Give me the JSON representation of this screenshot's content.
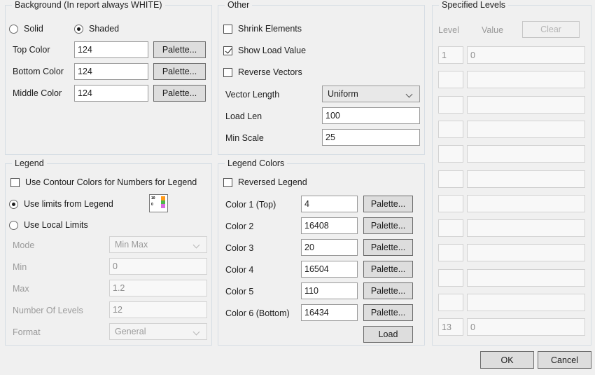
{
  "background_group": {
    "title": "Background (In report always WHITE)",
    "mode_options": [
      {
        "label": "Solid",
        "checked": false
      },
      {
        "label": "Shaded",
        "checked": true
      }
    ],
    "fields": [
      {
        "label": "Top Color",
        "value": "124",
        "button": "Palette..."
      },
      {
        "label": "Bottom Color",
        "value": "124",
        "button": "Palette..."
      },
      {
        "label": "Middle Color",
        "value": "124",
        "button": "Palette..."
      }
    ]
  },
  "legend_group": {
    "title": "Legend",
    "use_contour_colors": {
      "label": "Use Contour Colors for Numbers for Legend",
      "checked": false
    },
    "limits_options": [
      {
        "label": "Use limits from Legend",
        "checked": true
      },
      {
        "label": "Use Local Limits",
        "checked": false
      }
    ],
    "legend_icon": {
      "name": "legend-preview-icon",
      "top_text": "10",
      "bottom_text": "0",
      "colors": [
        "#ff9a18",
        "#4cb84c",
        "#d96ae0"
      ]
    },
    "mode": {
      "label": "Mode",
      "value": "Min Max",
      "disabled": true
    },
    "min": {
      "label": "Min",
      "value": "0",
      "disabled": true
    },
    "max": {
      "label": "Max",
      "value": "1.2",
      "disabled": true
    },
    "number_of_levels": {
      "label": "Number Of Levels",
      "value": "12",
      "disabled": true
    },
    "format": {
      "label": "Format",
      "value": "General",
      "disabled": true
    }
  },
  "other_group": {
    "title": "Other",
    "checkboxes": [
      {
        "label": "Shrink Elements",
        "checked": false
      },
      {
        "label": "Show Load Value",
        "checked": true
      },
      {
        "label": "Reverse Vectors",
        "checked": false
      }
    ],
    "vector_length": {
      "label": "Vector Length",
      "value": "Uniform"
    },
    "load_len": {
      "label": "Load Len",
      "value": "100"
    },
    "min_scale": {
      "label": "Min Scale",
      "value": "25"
    }
  },
  "legend_colors_group": {
    "title": "Legend Colors",
    "reversed_legend": {
      "label": "Reversed Legend",
      "checked": false
    },
    "palette_label": "Palette...",
    "load_label": "Load",
    "colors": [
      {
        "label": "Color 1 (Top)",
        "value": "4"
      },
      {
        "label": "Color 2",
        "value": "16408"
      },
      {
        "label": "Color 3",
        "value": "20"
      },
      {
        "label": "Color 4",
        "value": "16504"
      },
      {
        "label": "Color 5",
        "value": "110"
      },
      {
        "label": "Color 6 (Bottom)",
        "value": "16434"
      }
    ]
  },
  "specified_levels_group": {
    "title": "Specified Levels",
    "col_level": "Level",
    "col_value": "Value",
    "clear_label": "Clear",
    "clear_disabled": true,
    "rows": [
      {
        "level": "1",
        "value": "0"
      },
      {
        "level": "",
        "value": ""
      },
      {
        "level": "",
        "value": ""
      },
      {
        "level": "",
        "value": ""
      },
      {
        "level": "",
        "value": ""
      },
      {
        "level": "",
        "value": ""
      },
      {
        "level": "",
        "value": ""
      },
      {
        "level": "",
        "value": ""
      },
      {
        "level": "",
        "value": ""
      },
      {
        "level": "",
        "value": ""
      },
      {
        "level": "",
        "value": ""
      },
      {
        "level": "13",
        "value": "0"
      }
    ]
  },
  "dialog_buttons": {
    "ok": "OK",
    "cancel": "Cancel"
  }
}
